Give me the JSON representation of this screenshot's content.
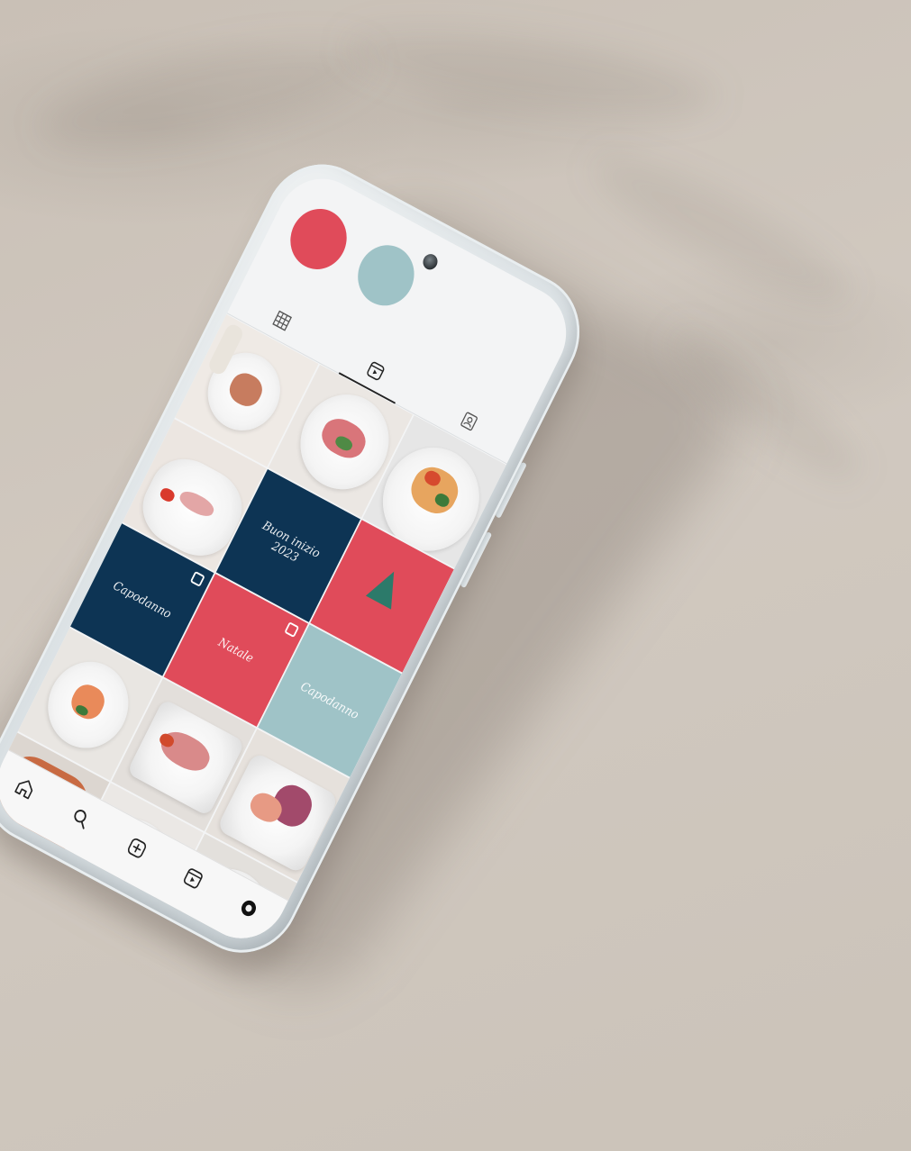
{
  "highlights": [
    {
      "label": "",
      "color": "#e04b5a"
    },
    {
      "label": "",
      "color": "#9fc3c7"
    }
  ],
  "profile_tabs": [
    {
      "name": "grid",
      "icon": "grid-icon",
      "active": false
    },
    {
      "name": "reels",
      "icon": "reels-icon",
      "active": true
    },
    {
      "name": "tagged",
      "icon": "tagged-icon",
      "active": false
    }
  ],
  "posts": [
    {
      "kind": "photo",
      "subject": "seafood-plate"
    },
    {
      "kind": "photo",
      "subject": "salmon-salad"
    },
    {
      "kind": "photo",
      "subject": "salmon-vegetables"
    },
    {
      "kind": "photo",
      "subject": "carpaccio"
    },
    {
      "kind": "graphic",
      "color": "#0d3454",
      "title": "Buon inizio 2023",
      "subtitle": "",
      "multiple": false
    },
    {
      "kind": "graphic",
      "color": "#e04b5a",
      "title": "",
      "subtitle": "",
      "multiple": false,
      "tree": true
    },
    {
      "kind": "graphic",
      "color": "#0d3454",
      "title": "Capodanno",
      "subtitle": "",
      "multiple": true
    },
    {
      "kind": "graphic",
      "color": "#e04b5a",
      "title": "Natale",
      "subtitle": "",
      "multiple": true
    },
    {
      "kind": "graphic",
      "color": "#9fc3c7",
      "title": "Capodanno",
      "subtitle": "",
      "multiple": false
    },
    {
      "kind": "photo",
      "subject": "shrimp-plate"
    },
    {
      "kind": "photo",
      "subject": "prosciutto-plate"
    },
    {
      "kind": "photo",
      "subject": "salmon-cabbage"
    },
    {
      "kind": "photo",
      "subject": "grilled-fish"
    },
    {
      "kind": "photo",
      "subject": "cured-meat"
    },
    {
      "kind": "photo",
      "subject": "oysters"
    }
  ],
  "bottom_nav": [
    {
      "name": "home",
      "icon": "home-icon"
    },
    {
      "name": "search",
      "icon": "search-icon"
    },
    {
      "name": "create",
      "icon": "plus-square-icon"
    },
    {
      "name": "reels",
      "icon": "reels-icon"
    },
    {
      "name": "profile",
      "icon": "profile-avatar-icon"
    }
  ],
  "colors": {
    "navy": "#0d3454",
    "coral": "#e04b5a",
    "teal": "#9fc3c7",
    "background": "#cfc6bd",
    "phone_body": "#dde3e6"
  }
}
